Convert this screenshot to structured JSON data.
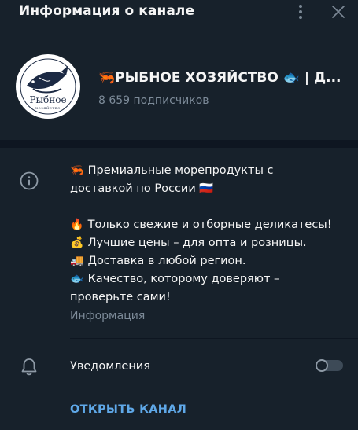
{
  "header": {
    "title": "Информация о канале",
    "menu_icon": "more-vertical-icon",
    "close_icon": "close-icon"
  },
  "channel": {
    "name": "🦐РЫБНОЕ ХОЗЯЙСТВО 🐟 | Д...",
    "subscribers": "8 659 подписчиков",
    "avatar": {
      "logo_text": "Рыбное",
      "logo_subtext": "ХОЗЯЙСТВО"
    }
  },
  "description": {
    "line1": "Премиальные морепродукты с",
    "line2": "доставкой по России 🇷🇺",
    "line3": "Только свежие и отборные деликатесы!",
    "line4": "Лучшие цены – для опта и розницы.",
    "line5": "Доставка в любой регион.",
    "line6": "Качество, которому доверяют –",
    "line7": "проверьте сами!",
    "emoji1": "🦐",
    "emoji3": "🔥",
    "emoji4": "💰",
    "emoji5": "🚚",
    "emoji6": "🐟",
    "label": "Информация"
  },
  "notifications": {
    "label": "Уведомления",
    "enabled": false
  },
  "actions": {
    "open_channel": "ОТКРЫТЬ КАНАЛ"
  },
  "colors": {
    "background": "#17212b",
    "divider": "#0e1621",
    "accent": "#5fa8e8",
    "secondary_text": "#7d8b99"
  }
}
